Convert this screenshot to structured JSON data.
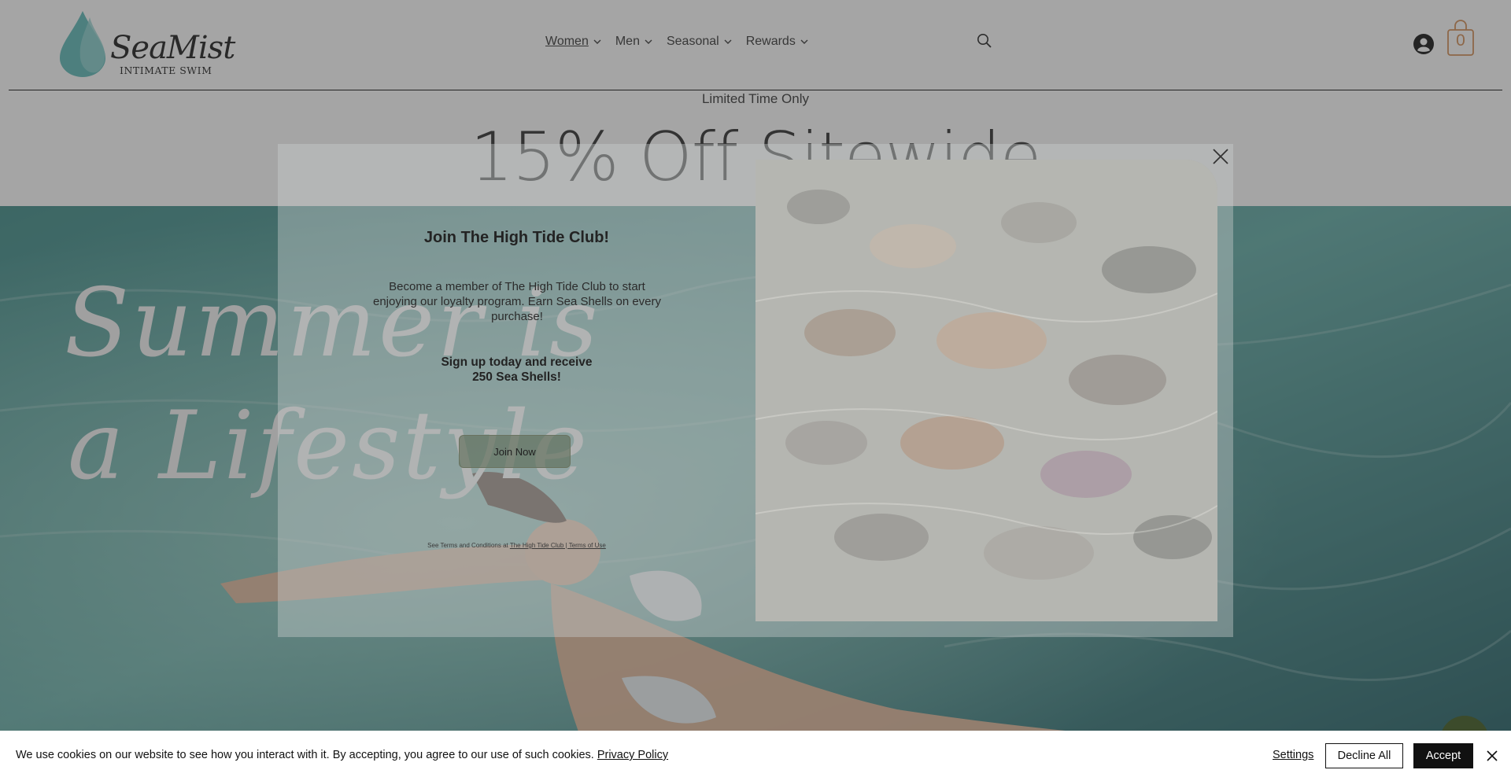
{
  "brand": {
    "name": "SeaMist",
    "tagline": "INTIMATE SWIM",
    "logo_icon": "water-drop-icon",
    "accent": "#5bb7b5"
  },
  "nav": {
    "items": [
      {
        "label": "Women",
        "icon": "chevron-down-icon",
        "active": true
      },
      {
        "label": "Men",
        "icon": "chevron-down-icon"
      },
      {
        "label": "Seasonal",
        "icon": "chevron-down-icon"
      },
      {
        "label": "Rewards",
        "icon": "chevron-down-icon"
      }
    ]
  },
  "header": {
    "search_icon": "search-icon",
    "account_icon": "account-icon",
    "cart_icon": "shopping-bag-icon",
    "cart_count": "0",
    "cart_color": "#d08a52"
  },
  "promo": {
    "kicker": "Limited Time Only",
    "headline": "15% Off Sitewide"
  },
  "hero": {
    "line1": "Summer is",
    "line2": "a Lifestyle"
  },
  "popup": {
    "title": "Join The High Tide Club!",
    "body": "Become a member of The High Tide Club to start enjoying our loyalty program. Earn Sea Shells on every purchase!",
    "offer_line1": "Sign up today and receive",
    "offer_line2": "250 Sea Shells!",
    "button": "Join Now",
    "terms_prefix": "See Terms and Conditions at ",
    "terms_link": "The High Tide Club | Terms of Use",
    "close_icon": "close-icon"
  },
  "chat": {
    "icon": "chat-icon"
  },
  "cookie": {
    "message": "We use cookies on our website to see how you interact with it. By accepting, you agree to our use of such cookies. ",
    "policy_link": "Privacy Policy",
    "settings": "Settings",
    "decline": "Decline All",
    "accept": "Accept",
    "close_icon": "close-icon"
  }
}
